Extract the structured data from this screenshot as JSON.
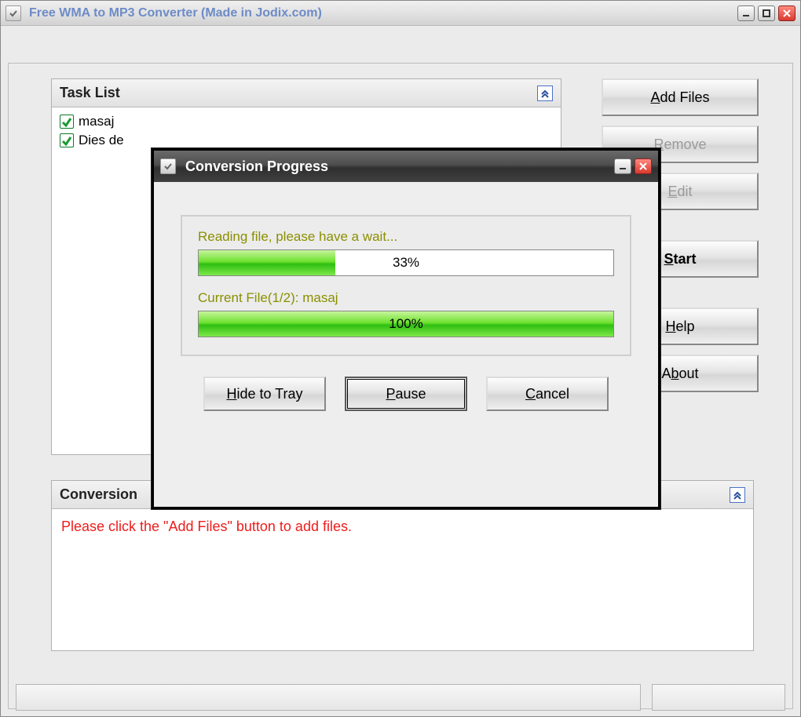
{
  "main_window": {
    "title": "Free WMA to MP3 Converter   (Made in Jodix.com)"
  },
  "task_list": {
    "header": "Task List",
    "items": [
      {
        "label": "masaj",
        "checked": true
      },
      {
        "label": "Dies de",
        "checked": true
      }
    ]
  },
  "side_buttons": {
    "add": "Add Files",
    "remove": "Remove",
    "edit": "Edit",
    "start": "Start",
    "help": "Help",
    "about": "About"
  },
  "output_panel": {
    "header": "Conversion",
    "message": "Please click the \"Add Files\" button to add files."
  },
  "dialog": {
    "title": "Conversion Progress",
    "reading_label": "Reading file, please have a wait...",
    "reading_percent": "33%",
    "reading_fill": 33,
    "current_label": "Current File(1/2): masaj",
    "current_percent": "100%",
    "current_fill": 100,
    "buttons": {
      "hide": "Hide to Tray",
      "pause": "Pause",
      "cancel": "Cancel"
    }
  }
}
